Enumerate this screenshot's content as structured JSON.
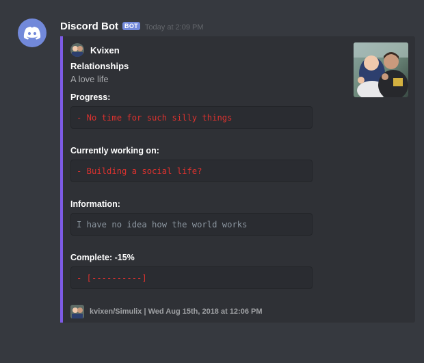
{
  "message": {
    "username": "Discord Bot",
    "bot_tag": "BOT",
    "timestamp": "Today at 2:09 PM",
    "avatar_icon": "discord-logo-icon",
    "avatar_color": "#7289da"
  },
  "embed": {
    "accent_color": "#7d5be6",
    "author": "Kvixen",
    "title": "Relationships",
    "description": "A love life",
    "fields": [
      {
        "name": "Progress:",
        "value": "- No time for such silly things"
      },
      {
        "name": "Currently working on:",
        "value": "- Building a social life?"
      },
      {
        "name": "Information:",
        "value": "I have no idea how the world works"
      },
      {
        "name": "Complete: -15%",
        "value": "- [----------]"
      }
    ],
    "footer": "kvixen/Simulix | Wed Aug 15th, 2018 at 12:06 PM"
  }
}
